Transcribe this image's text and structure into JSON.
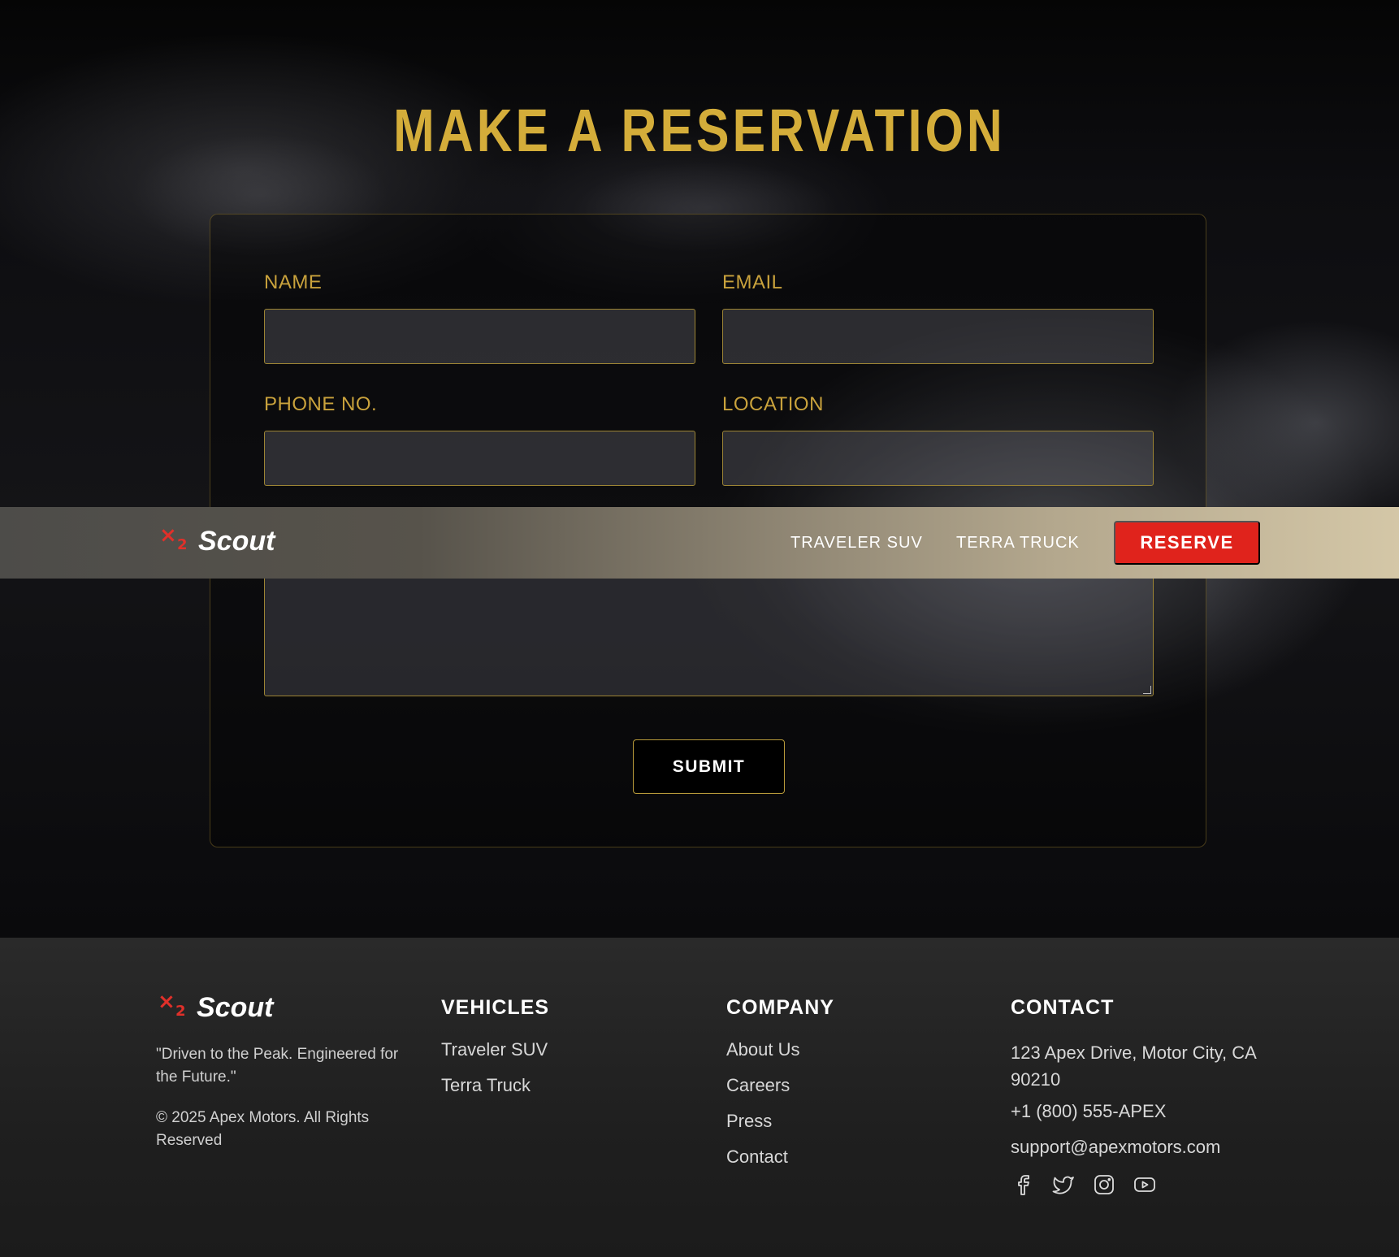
{
  "reservation": {
    "title": "MAKE A RESERVATION",
    "fields": {
      "name_label": "NAME",
      "email_label": "EMAIL",
      "phone_label": "PHONE NO.",
      "location_label": "LOCATION"
    },
    "submit_label": "SUBMIT"
  },
  "navbar": {
    "brand": {
      "mark_x": "×",
      "mark_sub": "2",
      "name": "Scout"
    },
    "links": [
      "TRAVELER SUV",
      "TERRA TRUCK"
    ],
    "cta_label": "RESERVE"
  },
  "footer": {
    "brand": {
      "mark_x": "×",
      "mark_sub": "2",
      "name": "Scout"
    },
    "tagline": "\"Driven to the Peak. Engineered for the Future.\"",
    "copyright": "© 2025 Apex Motors. All Rights Reserved",
    "vehicles": {
      "heading": "VEHICLES",
      "links": [
        "Traveler SUV",
        "Terra Truck"
      ]
    },
    "company": {
      "heading": "COMPANY",
      "links": [
        "About Us",
        "Careers",
        "Press",
        "Contact"
      ]
    },
    "contact": {
      "heading": "CONTACT",
      "address": "123 Apex Drive, Motor City, CA 90210",
      "phone": "+1 (800) 555-APEX",
      "email": "support@apexmotors.com",
      "social_icons": [
        "facebook-icon",
        "twitter-icon",
        "instagram-icon",
        "youtube-icon"
      ]
    }
  },
  "colors": {
    "gold": "#d4ad3a",
    "accent_red": "#e0231c",
    "footer_bg": "#232323"
  }
}
